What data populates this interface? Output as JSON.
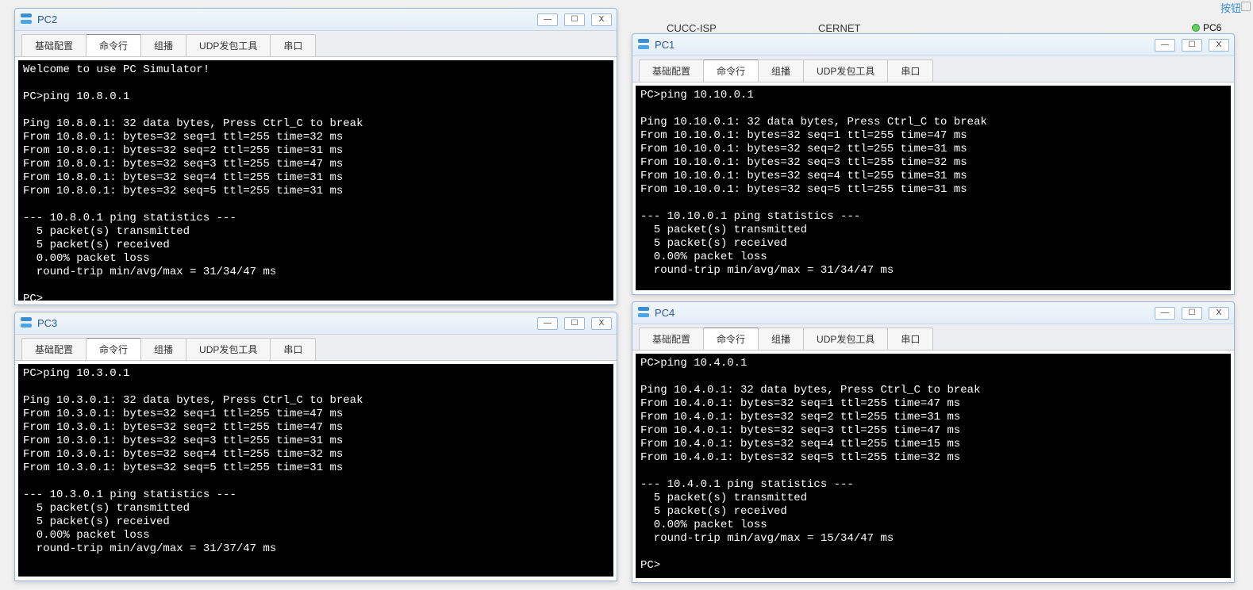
{
  "bg": {
    "label_cucc": "CUCC-ISP",
    "label_cernet": "CERNET",
    "node_pc6": "PC6",
    "button_label": "按钮"
  },
  "tabs": {
    "basic": "基础配置",
    "cmd": "命令行",
    "multicast": "组播",
    "udp": "UDP发包工具",
    "serial": "串口"
  },
  "controls": {
    "min": "—",
    "max": "☐",
    "close": "X"
  },
  "windows": {
    "pc2": {
      "title": "PC2",
      "terminal": "Welcome to use PC Simulator!\n\nPC>ping 10.8.0.1\n\nPing 10.8.0.1: 32 data bytes, Press Ctrl_C to break\nFrom 10.8.0.1: bytes=32 seq=1 ttl=255 time=32 ms\nFrom 10.8.0.1: bytes=32 seq=2 ttl=255 time=31 ms\nFrom 10.8.0.1: bytes=32 seq=3 ttl=255 time=47 ms\nFrom 10.8.0.1: bytes=32 seq=4 ttl=255 time=31 ms\nFrom 10.8.0.1: bytes=32 seq=5 ttl=255 time=31 ms\n\n--- 10.8.0.1 ping statistics ---\n  5 packet(s) transmitted\n  5 packet(s) received\n  0.00% packet loss\n  round-trip min/avg/max = 31/34/47 ms\n\nPC>"
    },
    "pc1": {
      "title": "PC1",
      "terminal": "PC>ping 10.10.0.1\n\nPing 10.10.0.1: 32 data bytes, Press Ctrl_C to break\nFrom 10.10.0.1: bytes=32 seq=1 ttl=255 time=47 ms\nFrom 10.10.0.1: bytes=32 seq=2 ttl=255 time=31 ms\nFrom 10.10.0.1: bytes=32 seq=3 ttl=255 time=32 ms\nFrom 10.10.0.1: bytes=32 seq=4 ttl=255 time=31 ms\nFrom 10.10.0.1: bytes=32 seq=5 ttl=255 time=31 ms\n\n--- 10.10.0.1 ping statistics ---\n  5 packet(s) transmitted\n  5 packet(s) received\n  0.00% packet loss\n  round-trip min/avg/max = 31/34/47 ms"
    },
    "pc3": {
      "title": "PC3",
      "terminal": "PC>ping 10.3.0.1\n\nPing 10.3.0.1: 32 data bytes, Press Ctrl_C to break\nFrom 10.3.0.1: bytes=32 seq=1 ttl=255 time=47 ms\nFrom 10.3.0.1: bytes=32 seq=2 ttl=255 time=47 ms\nFrom 10.3.0.1: bytes=32 seq=3 ttl=255 time=31 ms\nFrom 10.3.0.1: bytes=32 seq=4 ttl=255 time=32 ms\nFrom 10.3.0.1: bytes=32 seq=5 ttl=255 time=31 ms\n\n--- 10.3.0.1 ping statistics ---\n  5 packet(s) transmitted\n  5 packet(s) received\n  0.00% packet loss\n  round-trip min/avg/max = 31/37/47 ms"
    },
    "pc4": {
      "title": "PC4",
      "terminal": "PC>ping 10.4.0.1\n\nPing 10.4.0.1: 32 data bytes, Press Ctrl_C to break\nFrom 10.4.0.1: bytes=32 seq=1 ttl=255 time=47 ms\nFrom 10.4.0.1: bytes=32 seq=2 ttl=255 time=31 ms\nFrom 10.4.0.1: bytes=32 seq=3 ttl=255 time=47 ms\nFrom 10.4.0.1: bytes=32 seq=4 ttl=255 time=15 ms\nFrom 10.4.0.1: bytes=32 seq=5 ttl=255 time=32 ms\n\n--- 10.4.0.1 ping statistics ---\n  5 packet(s) transmitted\n  5 packet(s) received\n  0.00% packet loss\n  round-trip min/avg/max = 15/34/47 ms\n\nPC>"
    }
  }
}
